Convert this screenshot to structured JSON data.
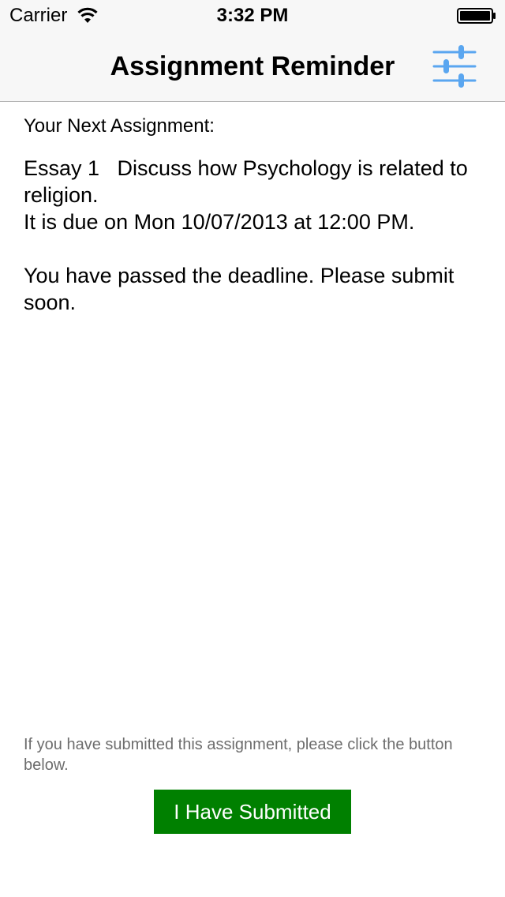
{
  "status_bar": {
    "carrier": "Carrier",
    "time": "3:32 PM",
    "wifi_icon": "wifi-icon",
    "battery_icon": "battery-full-icon"
  },
  "nav_bar": {
    "title": "Assignment Reminder",
    "settings_icon": "sliders-icon"
  },
  "content": {
    "next_label": "Your Next Assignment:",
    "assignment_line": "Essay 1   Discuss how Psychology is related to religion.",
    "due_line": "It is due on Mon 10/07/2013 at 12:00 PM.",
    "deadline_message": "You have passed the deadline. Please submit soon."
  },
  "footer": {
    "hint": "If you have submitted this assignment, please click the button below.",
    "submit_label": "I Have Submitted"
  },
  "colors": {
    "accent": "#4a90e2",
    "submit_button": "#008000",
    "hint_text": "#6d6d6d",
    "chrome": "#f7f7f7"
  }
}
